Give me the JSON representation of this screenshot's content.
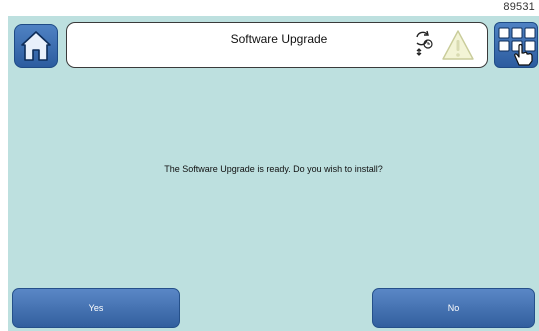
{
  "device": {
    "id_label": "89531"
  },
  "header": {
    "title": "Software Upgrade",
    "home_icon": "home-icon",
    "sync_icon": "sync-icon",
    "warning_icon": "warning-triangle-icon",
    "apps_icon": "apps-grid-icon"
  },
  "dialog": {
    "message": "The Software Upgrade is ready. Do you wish to install?",
    "yes_label": "Yes",
    "no_label": "No"
  },
  "colors": {
    "screen_bg": "#bde0df",
    "button_blue": "#3d6fb2",
    "title_bg": "#ffffff"
  }
}
